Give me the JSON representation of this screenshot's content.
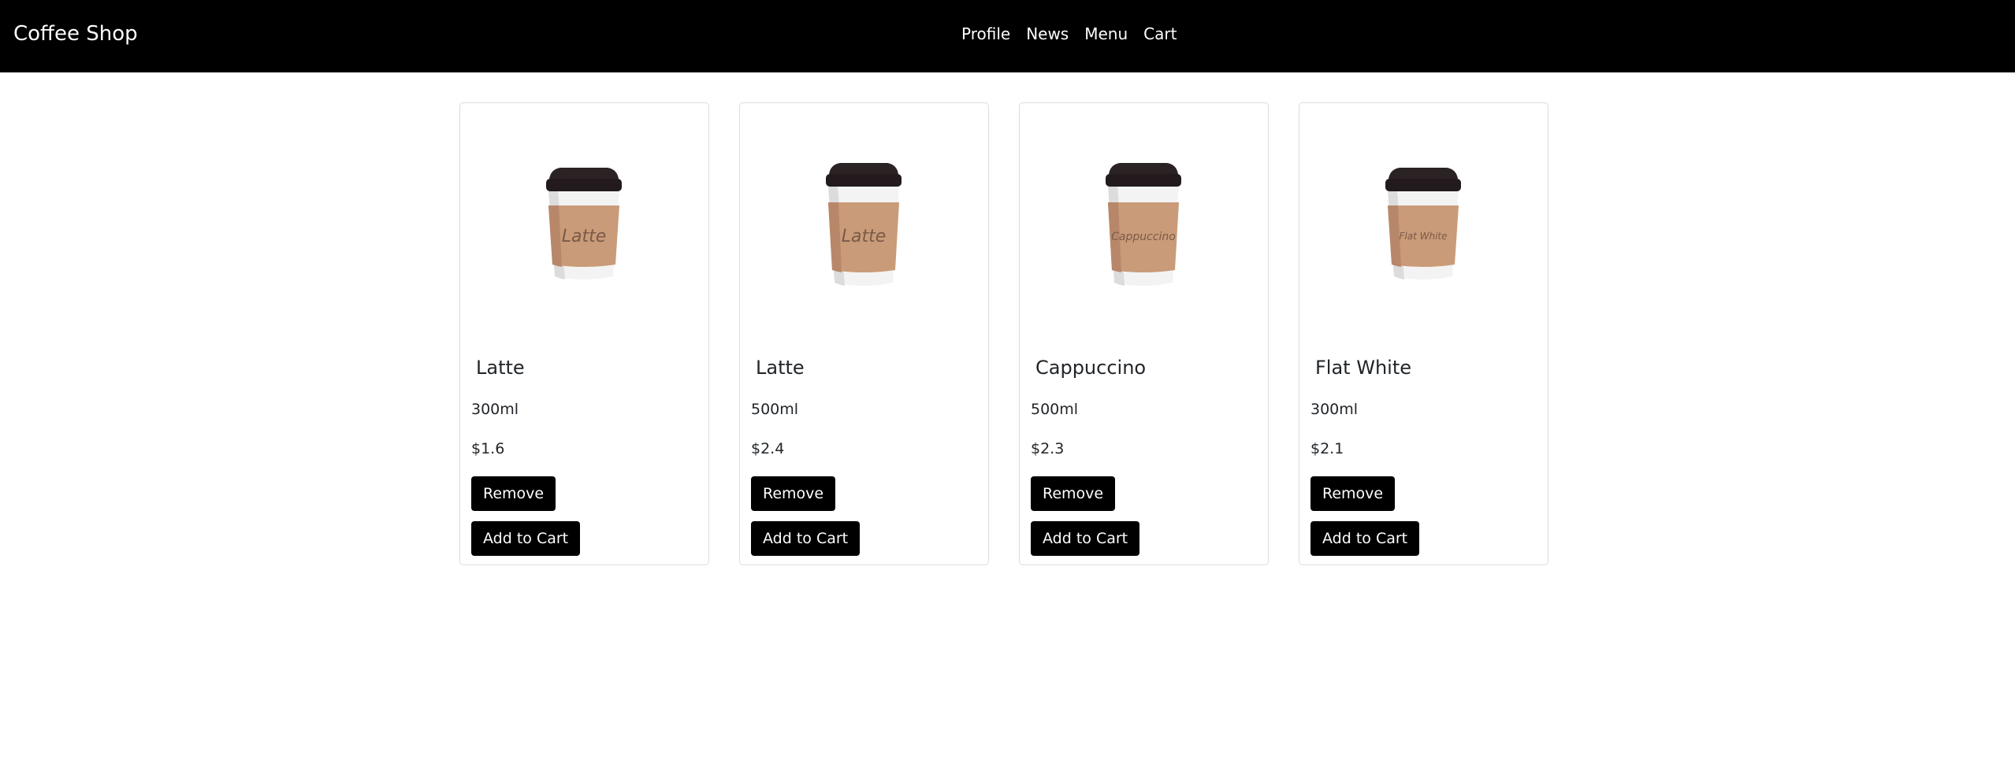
{
  "navbar": {
    "brand": "Coffee Shop",
    "links": [
      "Profile",
      "News",
      "Menu",
      "Cart"
    ]
  },
  "products": [
    {
      "name": "Latte",
      "size": "300ml",
      "price": "$1.6",
      "cup_label": "Latte"
    },
    {
      "name": "Latte",
      "size": "500ml",
      "price": "$2.4",
      "cup_label": "Latte"
    },
    {
      "name": "Cappuccino",
      "size": "500ml",
      "price": "$2.3",
      "cup_label": "Cappuccino"
    },
    {
      "name": "Flat White",
      "size": "300ml",
      "price": "$2.1",
      "cup_label": "Flat White"
    }
  ],
  "buttons": {
    "remove": "Remove",
    "add_to_cart": "Add to Cart"
  },
  "colors": {
    "navbar_bg": "#000000",
    "button_bg": "#000000",
    "cup_sleeve": "#c99b78",
    "cup_lid": "#221a1c"
  }
}
